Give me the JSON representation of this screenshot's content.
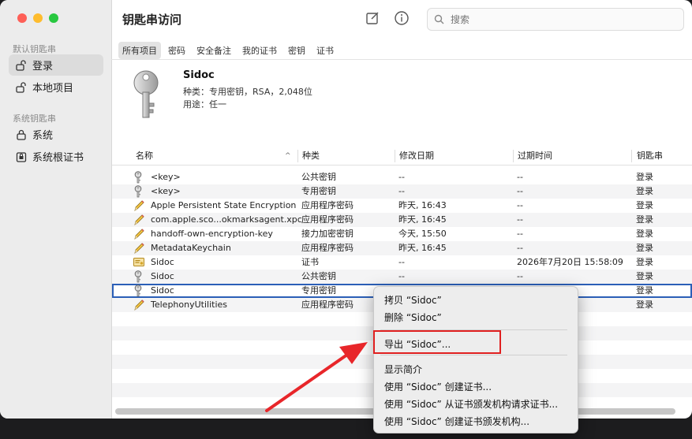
{
  "app": {
    "title": "钥匙串访问"
  },
  "sidebar": {
    "section1": "默认钥匙串",
    "items1": [
      {
        "label": "登录",
        "icon": "unlocked-icon"
      },
      {
        "label": "本地项目",
        "icon": "unlocked-icon"
      }
    ],
    "section2": "系统钥匙串",
    "items2": [
      {
        "label": "系统",
        "icon": "lock-icon"
      },
      {
        "label": "系统根证书",
        "icon": "cert-box-icon"
      }
    ]
  },
  "search": {
    "placeholder": "搜索"
  },
  "tabs": [
    "所有项目",
    "密码",
    "安全备注",
    "我的证书",
    "密钥",
    "证书"
  ],
  "detail": {
    "name": "Sidoc",
    "kind": "种类：专用密钥，RSA，2,048位",
    "usage": "用途：任一"
  },
  "table": {
    "headers": [
      "名称",
      "种类",
      "修改日期",
      "过期时间",
      "钥匙串"
    ],
    "rows": [
      {
        "icon": "key-icon",
        "name": "<key>",
        "kind": "公共密钥",
        "modified": "--",
        "expires": "--",
        "keychain": "登录"
      },
      {
        "icon": "key-icon",
        "name": "<key>",
        "kind": "专用密钥",
        "modified": "--",
        "expires": "--",
        "keychain": "登录"
      },
      {
        "icon": "pencil-icon",
        "name": "Apple Persistent State Encryption",
        "kind": "应用程序密码",
        "modified": "昨天, 16:43",
        "expires": "--",
        "keychain": "登录"
      },
      {
        "icon": "pencil-icon",
        "name": "com.apple.sco...okmarksagent.xpc",
        "kind": "应用程序密码",
        "modified": "昨天, 16:45",
        "expires": "--",
        "keychain": "登录"
      },
      {
        "icon": "pencil-icon",
        "name": "handoff-own-encryption-key",
        "kind": "接力加密密钥",
        "modified": "今天, 15:50",
        "expires": "--",
        "keychain": "登录"
      },
      {
        "icon": "pencil-icon",
        "name": "MetadataKeychain",
        "kind": "应用程序密码",
        "modified": "昨天, 16:45",
        "expires": "--",
        "keychain": "登录"
      },
      {
        "icon": "certificate-icon",
        "name": "Sidoc",
        "kind": "证书",
        "modified": "--",
        "expires": "2026年7月20日 15:58:09",
        "keychain": "登录"
      },
      {
        "icon": "key-icon",
        "name": "Sidoc",
        "kind": "公共密钥",
        "modified": "--",
        "expires": "--",
        "keychain": "登录"
      },
      {
        "icon": "key-icon",
        "name": "Sidoc",
        "kind": "专用密钥",
        "modified": "",
        "expires": "",
        "keychain": "登录"
      },
      {
        "icon": "pencil-icon",
        "name": "TelephonyUtilities",
        "kind": "应用程序密码",
        "modified": "",
        "expires": "",
        "keychain": "登录"
      }
    ]
  },
  "context_menu": {
    "items": [
      "拷贝 “Sidoc”",
      "删除 “Sidoc”",
      "导出 “Sidoc”...",
      "显示简介",
      "使用 “Sidoc” 创建证书...",
      "使用 “Sidoc” 从证书颁发机构请求证书...",
      "使用 “Sidoc” 创建证书颁发机构..."
    ]
  },
  "colors": {
    "highlight_box": "#e02020",
    "arrow": "#e8262a",
    "selection": "#2b5fb7"
  }
}
